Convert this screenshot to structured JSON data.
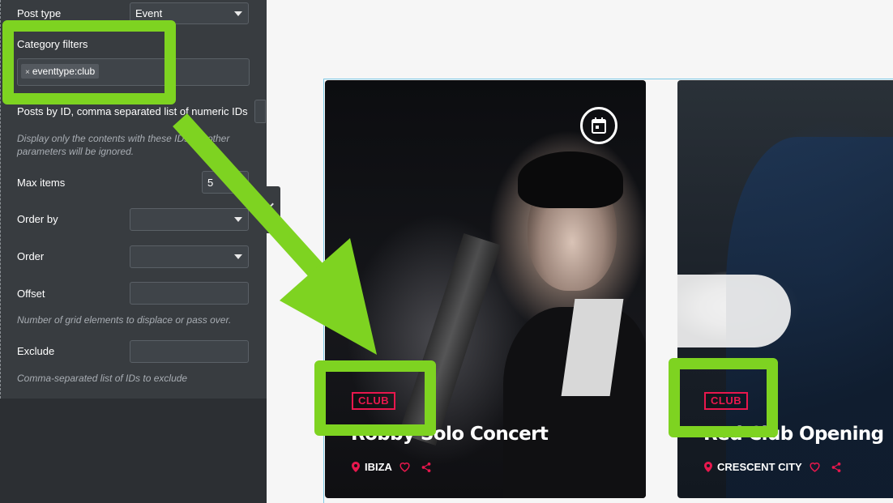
{
  "panel": {
    "post_type": {
      "label": "Post type",
      "value": "Event"
    },
    "category_filters": {
      "label": "Category filters",
      "tag": "eventtype:club",
      "tag_remove": "×"
    },
    "posts_by_id": {
      "label": "Posts by ID, comma separated list of numeric IDs",
      "help": "Display only the contents with these IDs. All other parameters will be ignored."
    },
    "max_items": {
      "label": "Max items",
      "value": "5"
    },
    "order_by": {
      "label": "Order by",
      "value": ""
    },
    "order": {
      "label": "Order",
      "value": ""
    },
    "offset": {
      "label": "Offset",
      "value": "",
      "help": "Number of grid elements to displace or pass over."
    },
    "exclude": {
      "label": "Exclude",
      "value": "",
      "help": "Comma-separated list of IDs to exclude"
    }
  },
  "cards": [
    {
      "badge": "CLUB",
      "title": "Robby Solo Concert",
      "location": "IBIZA",
      "icons": [
        "calendar-icon",
        "pin-icon",
        "heart-icon",
        "share-icon"
      ]
    },
    {
      "badge": "CLUB",
      "title": "Red Club Opening",
      "location": "CRESCENT CITY",
      "icons": [
        "pin-icon",
        "heart-icon",
        "share-icon"
      ]
    }
  ],
  "colors": {
    "accent": "#e8174d",
    "highlight": "#7ed321",
    "panel": "#383c40"
  }
}
